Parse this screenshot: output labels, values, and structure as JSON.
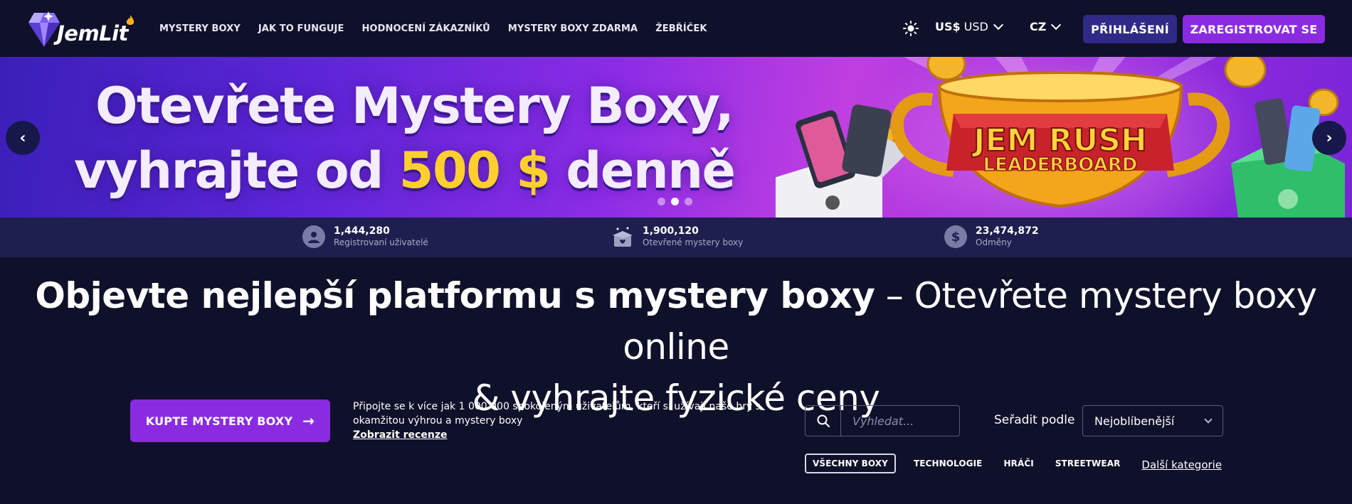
{
  "header": {
    "logo_text": "JemLit",
    "nav": [
      "MYSTERY BOXY",
      "JAK TO FUNGUJE",
      "HODNOCENÍ ZÁKAZNÍKŮ",
      "MYSTERY BOXY ZDARMA",
      "ŽEBŘÍČEK"
    ],
    "currency_symbol": "US$",
    "currency_code": "USD",
    "language": "CZ",
    "login_label": "PŘIHLÁŠENÍ",
    "register_label": "ZAREGISTROVAT SE"
  },
  "banner": {
    "line1": "Otevřete Mystery Boxy,",
    "line2_before": "vyhrajte od ",
    "line2_highlight": "500 $",
    "line2_after": " denně",
    "trophy_line1": "JEM RUSH",
    "trophy_line2": "LEADERBOARD",
    "prev_arrow": "‹",
    "next_arrow": "›",
    "slide_count": 3,
    "active_slide": 2
  },
  "stats": [
    {
      "value": "1,444,280",
      "label": "Registrovaní uživatelé",
      "icon": "user-icon"
    },
    {
      "value": "1,900,120",
      "label": "Otevřené mystery boxy",
      "icon": "open-box-icon"
    },
    {
      "value": "23,474,872",
      "label": "Odměny",
      "icon": "dollar-icon"
    }
  ],
  "headline": {
    "bold": "Objevte nejlepší platformu s mystery boxy",
    "rest_line1": " – Otevřete mystery boxy online",
    "rest_line2": "& vyhrajte fyzické ceny"
  },
  "cta": {
    "buy_label": "KUPTE MYSTERY BOXY",
    "buy_arrow": "→",
    "promo_text": "Připojte se k více jak 1 000 000 spokojeným uživatelům, kteří si užívají naše hry s okamžitou výhrou a mystery boxy",
    "reviews_link": "Zobrazit recenze"
  },
  "filters": {
    "search_placeholder": "Vyhledat...",
    "sort_label": "Seřadit podle",
    "sort_value": "Nejoblíbenější",
    "categories": [
      "VŠECHNY BOXY",
      "TECHNOLOGIE",
      "HRÁČI",
      "STREETWEAR"
    ],
    "more_categories": "Další kategorie"
  },
  "colors": {
    "background": "#0f1029",
    "stats_bar": "#1e1f4e",
    "login_button": "#2e2a86",
    "accent_purple": "#8a2be2",
    "highlight_gold": "#ffcf2e"
  }
}
